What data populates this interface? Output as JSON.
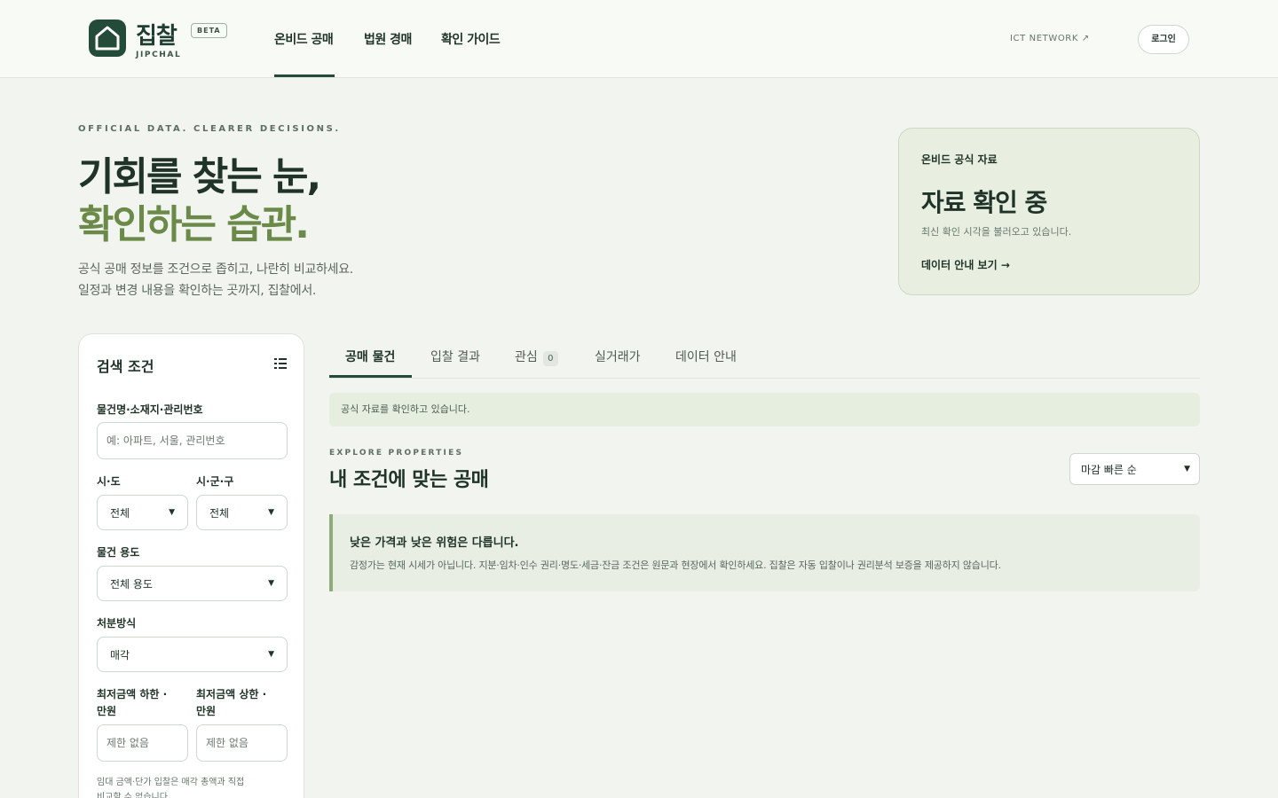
{
  "header": {
    "logo_name": "집찰",
    "logo_sub": "JIPCHAL",
    "beta_badge": "BETA",
    "nav": [
      {
        "label": "온비드 공매"
      },
      {
        "label": "법원 경매"
      },
      {
        "label": "확인 가이드"
      }
    ],
    "ict_link": "ICT NETWORK ↗",
    "login_label": "로그인"
  },
  "hero": {
    "eyebrow": "OFFICIAL DATA. CLEARER DECISIONS.",
    "headline_line1": "기회를 찾는 눈,",
    "headline_line2": "확인하는 습관.",
    "desc_line1": "공식 공매 정보를 조건으로 좁히고, 나란히 비교하세요.",
    "desc_line2": "일정과 변경 내용을 확인하는 곳까지, 집찰에서."
  },
  "status_card": {
    "label": "온비드 공식 자료",
    "title": "자료 확인 중",
    "subtitle": "최신 확인 시각을 불러오고 있습니다.",
    "link": "데이터 안내 보기 →"
  },
  "sidebar": {
    "title": "검색 조건",
    "keyword_label": "물건명·소재지·관리번호",
    "keyword_placeholder": "예: 아파트, 서울, 관리번호",
    "sido_label": "시·도",
    "sido_value": "전체",
    "sigungu_label": "시·군·구",
    "sigungu_value": "전체",
    "usage_label": "물건 용도",
    "usage_value": "전체 용도",
    "disposal_label": "처분방식",
    "disposal_value": "매각",
    "min_price_label_1": "최저금액 하한 ·",
    "min_price_label_2": "만원",
    "max_price_label_1": "최저금액 상한 ·",
    "max_price_label_2": "만원",
    "min_price_placeholder": "제한 없음",
    "max_price_placeholder": "제한 없음",
    "hint_line1": "임대 금액·단가 입찰은 매각 총액과 직접",
    "hint_line2": "비교할 수 없습니다."
  },
  "tabs": [
    {
      "label": "공매 물건"
    },
    {
      "label": "입찰 결과"
    },
    {
      "label": "관심",
      "count": "0"
    },
    {
      "label": "실거래가"
    },
    {
      "label": "데이터 안내"
    }
  ],
  "main": {
    "notice": "공식 자료를 확인하고 있습니다.",
    "eyebrow": "EXPLORE PROPERTIES",
    "title": "내 조건에 맞는 공매",
    "sort_value": "마감 빠른 순",
    "warning_title": "낮은 가격과 낮은 위험은 다릅니다.",
    "warning_body": "감정가는 현재 시세가 아닙니다. 지분·임차·인수 권리·명도·세금·잔금 조건은 원문과 현장에서 확인하세요. 집찰은 자동 입찰이나 권리분석 보증을 제공하지 않습니다."
  },
  "colors": {
    "brand": "#244b3a",
    "accent_green": "#6b8a4a",
    "background": "#f2f5ef"
  }
}
